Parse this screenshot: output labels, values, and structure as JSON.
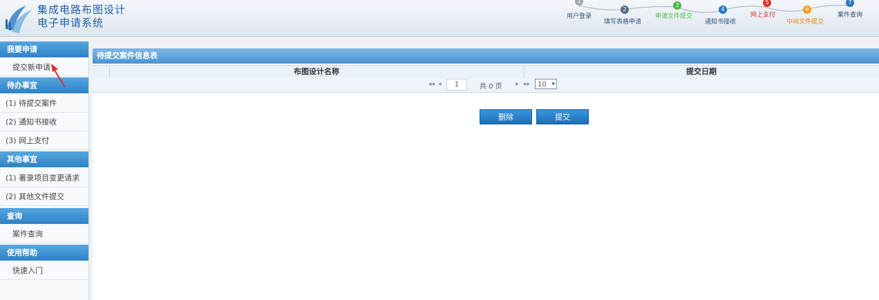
{
  "app": {
    "title_line1": "集成电路布图设计",
    "title_line2": "电子申请系统"
  },
  "steps": [
    {
      "num": "1",
      "label": "用户登录",
      "color": "#a0a6ad"
    },
    {
      "num": "2",
      "label": "填写表格申请",
      "color": "#5a6b82"
    },
    {
      "num": "3",
      "label": "申请文件提交",
      "color": "#4cb848"
    },
    {
      "num": "4",
      "label": "通知书接收",
      "color": "#2a77c6"
    },
    {
      "num": "5",
      "label": "网上支付",
      "color": "#d9342b"
    },
    {
      "num": "6",
      "label": "中间文件提交",
      "color": "#f39c12"
    },
    {
      "num": "7",
      "label": "案件查询",
      "color": "#2a77c6"
    }
  ],
  "sidebar": {
    "sections": [
      {
        "title": "我要申请",
        "items": [
          "提交新申请"
        ]
      },
      {
        "title": "待办事宜",
        "items": [
          "(1) 待提交案件",
          "(2) 通知书接收",
          "(3) 网上支付"
        ]
      },
      {
        "title": "其他事宜",
        "items": [
          "(1) 著录项目变更请求",
          "(2) 其他文件提交"
        ]
      },
      {
        "title": "查询",
        "items": [
          "案件查询"
        ]
      },
      {
        "title": "使用帮助",
        "items": [
          "快速入门"
        ]
      }
    ]
  },
  "panel": {
    "title": "待提交案件信息表",
    "columns": [
      "布图设计名称",
      "提交日期"
    ],
    "pager": {
      "current_page": "1",
      "total_text": "共 0 页",
      "page_size": "10"
    }
  },
  "buttons": {
    "delete": "删除",
    "submit": "提交"
  }
}
